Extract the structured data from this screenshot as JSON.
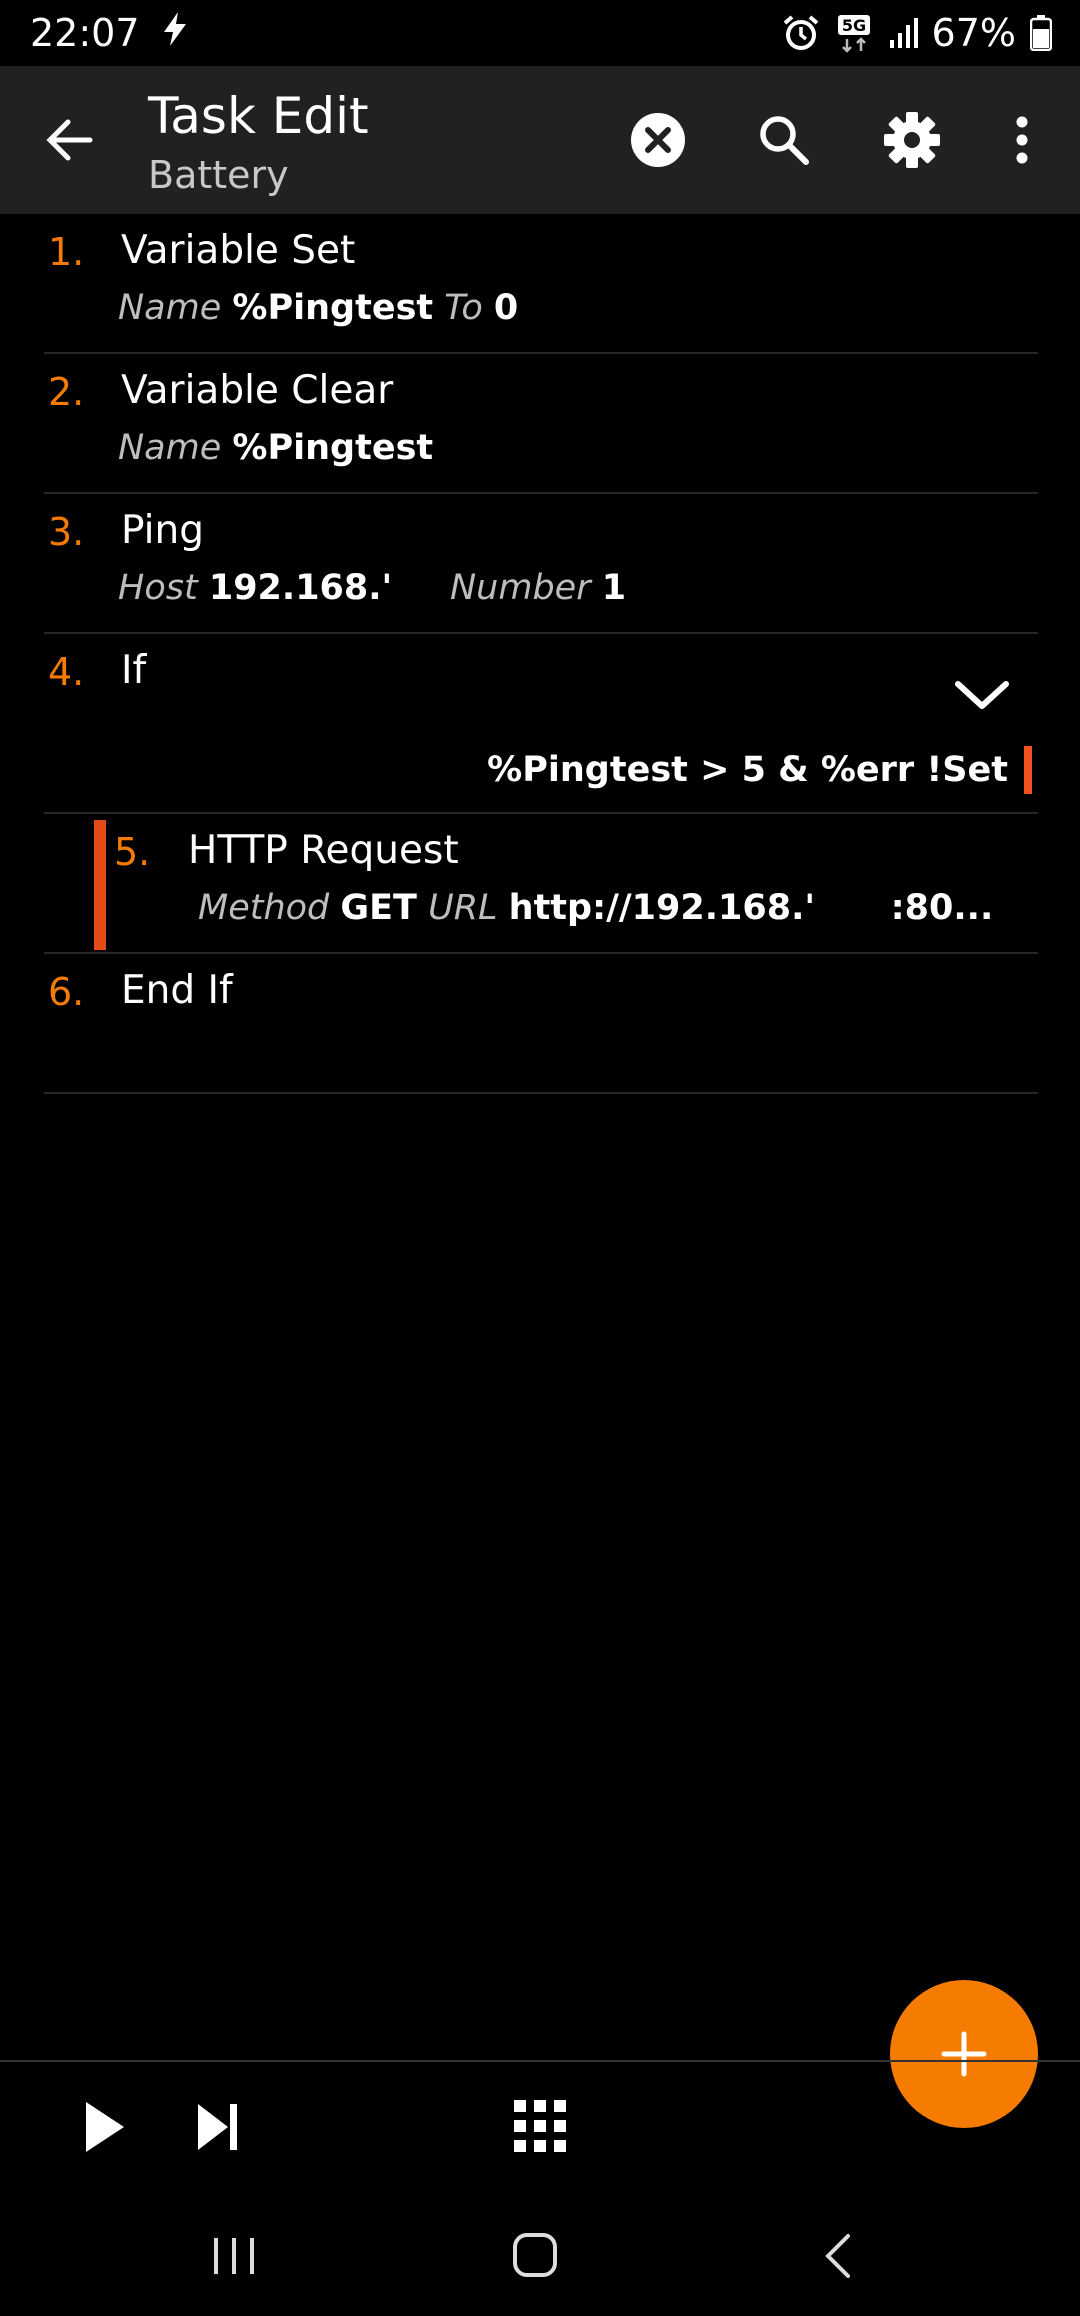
{
  "status_bar": {
    "time": "22:07",
    "battery": "67%",
    "network": "5G",
    "icons": [
      "bolt-icon",
      "alarm-icon",
      "5g-icon",
      "signal-icon",
      "battery-icon"
    ]
  },
  "app_bar": {
    "title": "Task Edit",
    "subtitle": "Battery",
    "icons": [
      "back-arrow-icon",
      "clear-circle-icon",
      "search-icon",
      "gear-icon",
      "more-vert-icon"
    ]
  },
  "actions": [
    {
      "number": "1.",
      "name": "Variable Set",
      "args": [
        {
          "label": "Name",
          "value": "%Pingtest"
        },
        {
          "label": "To",
          "value": "0"
        }
      ]
    },
    {
      "number": "2.",
      "name": "Variable Clear",
      "args": [
        {
          "label": "Name",
          "value": "%Pingtest"
        }
      ]
    },
    {
      "number": "3.",
      "name": "Ping",
      "args": [
        {
          "label": "Host",
          "value": "192.168.'"
        },
        {
          "label": "Number",
          "value": "1"
        }
      ]
    },
    {
      "number": "4.",
      "name": "If",
      "condition": "%Pingtest > 5 & %err !Set"
    },
    {
      "number": "5.",
      "name": "HTTP Request",
      "args": [
        {
          "label": "Method",
          "value": "GET"
        },
        {
          "label": "URL",
          "value": "http://192.168.'"
        },
        {
          "label": "",
          "value": ":80..."
        }
      ]
    },
    {
      "number": "6.",
      "name": "End If"
    }
  ],
  "colors": {
    "accent": "#f57c00",
    "indent_bar": "#e64a19",
    "app_bar_bg": "#212121",
    "background": "#000000"
  },
  "bottom_toolbar": {
    "icons": [
      "play-icon",
      "skip-next-icon",
      "grid-icon",
      "add-icon"
    ]
  },
  "nav_bar": {
    "icons": [
      "recents-icon",
      "home-icon",
      "nav-back-icon"
    ]
  }
}
